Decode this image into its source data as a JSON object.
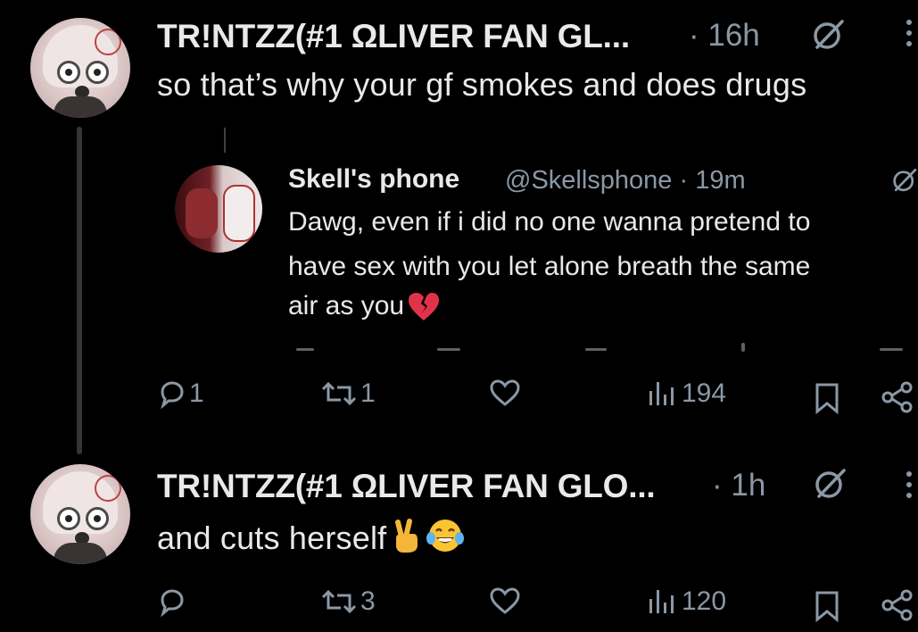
{
  "tweets": [
    {
      "author": "TR!NTZZ(#1 ΩLIVER FAN GL...",
      "time": "· 16h",
      "text": "so that’s why your gf smokes and does drugs",
      "actions": {
        "reply": "1",
        "retweet": "1",
        "like": "",
        "views": "194"
      }
    },
    {
      "author": "TR!NTZZ(#1 ΩLIVER FAN GLO...",
      "time": "· 1h",
      "text": "and cuts herself",
      "actions": {
        "reply": "",
        "retweet": "3",
        "like": "",
        "views": "120"
      }
    }
  ],
  "quoted": {
    "name": "Skell's phone",
    "handle": "@Skellsphone · 19m",
    "lines": [
      "Dawg, even if i did no one wanna pretend to",
      "have sex with you let alone breath the same",
      "air as you"
    ]
  },
  "icons": [
    "grok-icon",
    "more-icon",
    "reply-icon",
    "retweet-icon",
    "like-icon",
    "views-icon",
    "bookmark-icon",
    "share-icon",
    "broken-heart-emoji",
    "victory-hand-emoji",
    "tears-of-joy-emoji"
  ],
  "colors": {
    "background": "#000000",
    "text": "#e7e9ea",
    "muted": "#8b98a5",
    "thread": "#333639"
  }
}
